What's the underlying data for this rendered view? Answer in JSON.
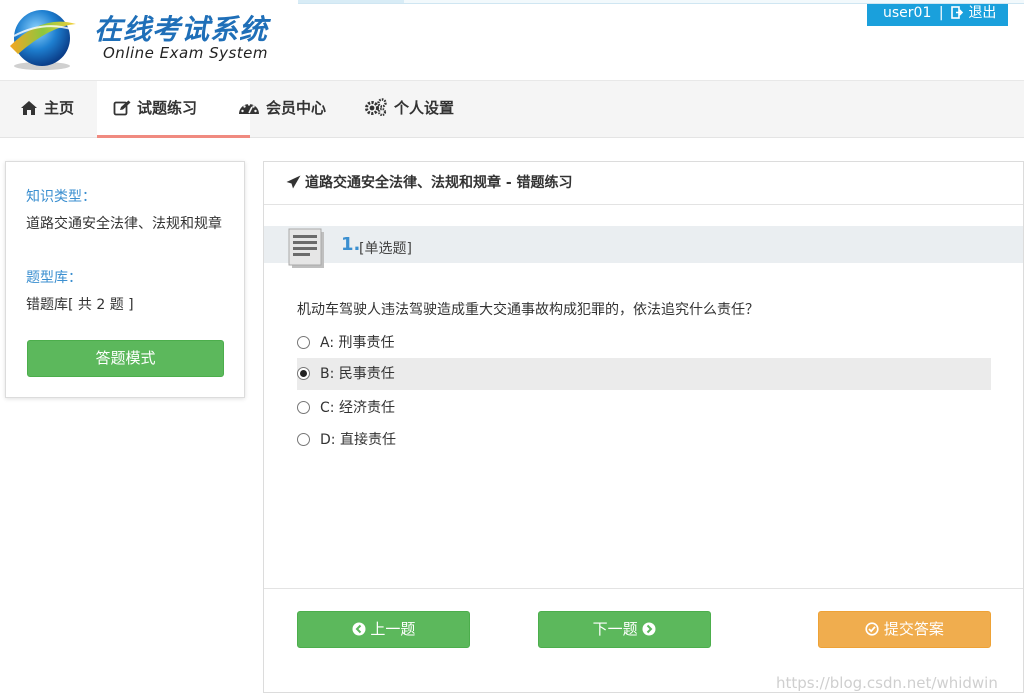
{
  "brand": {
    "title_cn": "在线考试系统",
    "title_en": "Online Exam System"
  },
  "user_bar": {
    "username": "user01",
    "separator": "|",
    "logout_label": "退出",
    "logout_icon": "sign-out-icon"
  },
  "nav": {
    "items": [
      {
        "label": "主页",
        "icon": "home-icon",
        "active": false
      },
      {
        "label": "试题练习",
        "icon": "edit-icon",
        "active": true
      },
      {
        "label": "会员中心",
        "icon": "dashboard-icon",
        "active": false
      },
      {
        "label": "个人设置",
        "icon": "gears-icon",
        "active": false
      }
    ]
  },
  "sidebar": {
    "knowledge_label": "知识类型：",
    "knowledge_value": "道路交通安全法律、法规和规章",
    "bank_label": "题型库：",
    "bank_value": "错题库[ 共 2 题 ]",
    "mode_button": "答题模式"
  },
  "panel": {
    "header_title": "道路交通安全法律、法规和规章 - 错题练习",
    "header_icon": "paper-plane-icon",
    "question_number": "1.",
    "question_type": "[单选题]",
    "question_text": "机动车驾驶人违法驾驶造成重大交通事故构成犯罪的，依法追究什么责任？",
    "options": [
      {
        "label": "A: 刑事责任",
        "selected": false
      },
      {
        "label": "B: 民事责任",
        "selected": true
      },
      {
        "label": "C: 经济责任",
        "selected": false
      },
      {
        "label": "D: 直接责任",
        "selected": false
      }
    ],
    "prev_button": "上一题",
    "next_button": "下一题",
    "submit_button": "提交答案"
  },
  "watermark": "https://blog.csdn.net/whidwin",
  "colors": {
    "brand_blue": "#1f6fb8",
    "user_bar_bg": "#1aa0dc",
    "label_blue": "#3b8fd0",
    "button_green": "#5cb85c",
    "button_orange": "#f0ad4e",
    "active_tab_underline": "#f08a80"
  }
}
